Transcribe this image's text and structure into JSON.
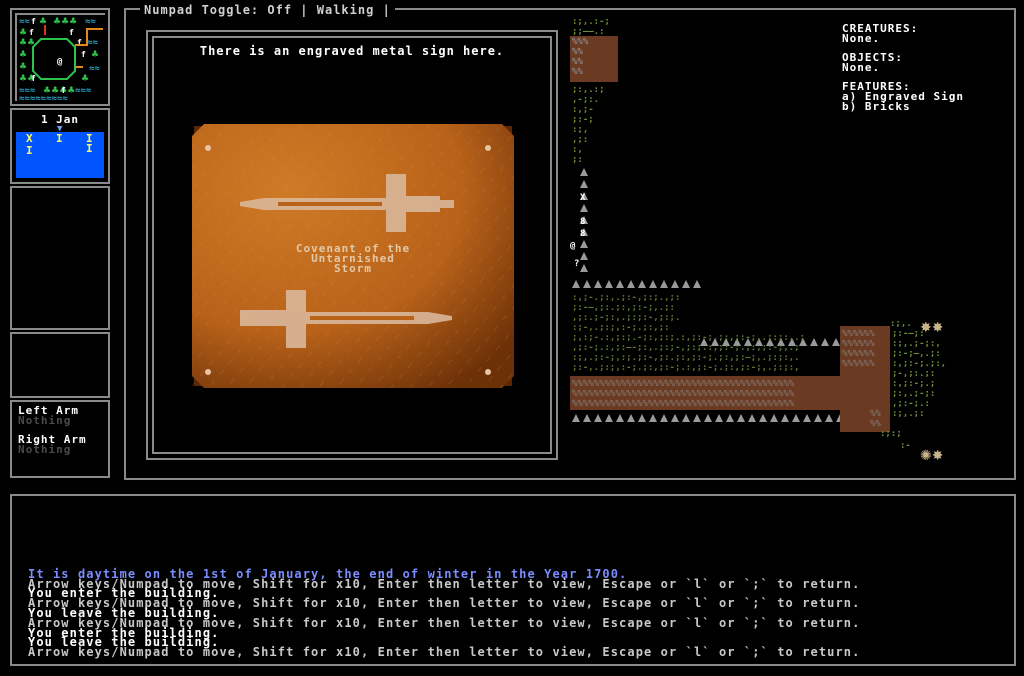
{
  "status": {
    "numpad_toggle": "Numpad Toggle: Off",
    "mode": "Walking",
    "separator": "|"
  },
  "minimap": {
    "rows": [
      "≈♣ff♣♣♣♣≈",
      "♣ff♣♣♣ ≈♣",
      "♣♣  f   ♣",
      "♣♣ @ ff ≈",
      "♣♣      ≈",
      "♣♣  ♣♣ ≈♣",
      "≈≈♣♣f♣♣≈≈",
      "≈≈≈♣♣≈≈≈≈"
    ]
  },
  "calendar": {
    "date": "1 Jan",
    "marker": "▼",
    "glyphs": [
      "X",
      "I",
      "I",
      "I",
      "I"
    ]
  },
  "arms": {
    "left_label": "Left Arm",
    "left_value": "Nothing",
    "right_label": "Right Arm",
    "right_value": "Nothing"
  },
  "sign": {
    "description": "There is an engraved metal sign here.",
    "plaque_line1": "Covenant of the",
    "plaque_line2": "Untarnished",
    "plaque_line3": "Storm"
  },
  "info": {
    "creatures_label": "CREATURES:",
    "creatures_value": "None.",
    "objects_label": "OBJECTS:",
    "objects_value": "None.",
    "features_label": "FEATURES:",
    "feature_a": "a) Engraved Sign",
    "feature_b": "b) Bricks"
  },
  "log": {
    "lines": [
      {
        "text": "It is daytime on the 1st of January, the end of winter in the Year 1700.",
        "color": "#7a8cff"
      },
      {
        "text": "Arrow keys/Numpad to move, Shift for x10, Enter then letter to view, Escape or `l` or `;` to return.",
        "color": "#c8c8c8"
      },
      {
        "text": "You enter the building.",
        "color": "#ffffff"
      },
      {
        "text": "Arrow keys/Numpad to move, Shift for x10, Enter then letter to view, Escape or `l` or `;` to return.",
        "color": "#c8c8c8"
      },
      {
        "text": "You leave the building.",
        "color": "#ffffff"
      },
      {
        "text": "Arrow keys/Numpad to move, Shift for x10, Enter then letter to view, Escape or `l` or `;` to return.",
        "color": "#c8c8c8"
      },
      {
        "text": "You enter the building.",
        "color": "#ffffff"
      },
      {
        "text": "You leave the building.",
        "color": "#ffffff"
      },
      {
        "text": "Arrow keys/Numpad to move, Shift for x10, Enter then letter to view, Escape or `l` or `;` to return.",
        "color": "#c8c8c8"
      }
    ]
  },
  "colors": {
    "frame": "#8a8a8a",
    "calendar_bg": "#0055ff",
    "plaque": "#c06a1e",
    "wall": "#6b3a22",
    "log_info": "#7a8cff"
  }
}
